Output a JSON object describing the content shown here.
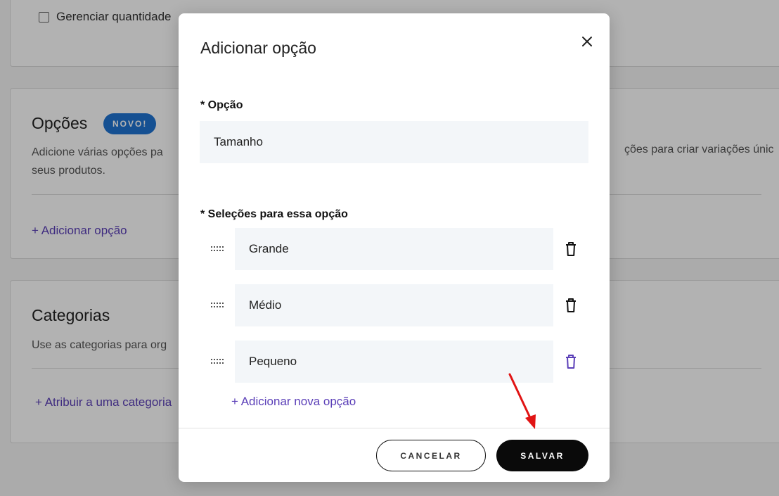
{
  "background": {
    "inventory": {
      "checkbox_label": "Gerenciar quantidade"
    },
    "options": {
      "title": "Opções",
      "badge": "NOVO!",
      "description_left": "Adicione várias opções pa",
      "description_line2": "seus produtos.",
      "description_right": "ções para criar variações únic",
      "add_link": "+ Adicionar opção"
    },
    "categories": {
      "title": "Categorias",
      "description": "Use as categorias para org",
      "assign_link": "+ Atribuir a uma categoria"
    }
  },
  "modal": {
    "title": "Adicionar opção",
    "option_label": "* Opção",
    "option_value": "Tamanho",
    "selections_label": "* Seleções para essa opção",
    "selections": [
      {
        "value": "Grande"
      },
      {
        "value": "Médio"
      },
      {
        "value": "Pequeno"
      }
    ],
    "add_new_label": "+ Adicionar nova opção",
    "cancel_label": "CANCELAR",
    "save_label": "SALVAR"
  },
  "colors": {
    "accent_link": "#5b3fb8",
    "badge": "#1f73d1",
    "save_button": "#0a0a0a",
    "annotation_arrow": "#e11414"
  }
}
